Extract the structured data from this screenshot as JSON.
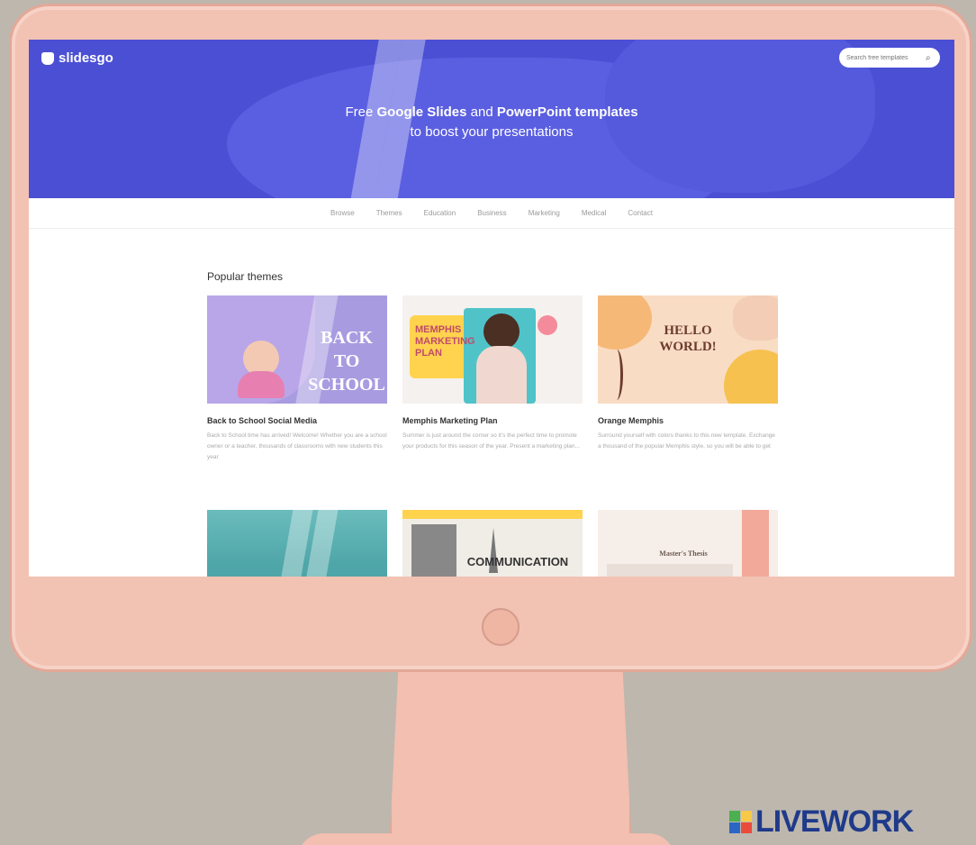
{
  "site": {
    "logo_text": "slidesgo",
    "search_placeholder": "Search free templates"
  },
  "hero": {
    "line1_pre": "Free ",
    "line1_b1": "Google Slides",
    "line1_mid": " and ",
    "line1_b2": "PowerPoint templates",
    "line2": "to boost your presentations"
  },
  "nav": [
    "Browse",
    "Themes",
    "Education",
    "Business",
    "Marketing",
    "Medical",
    "Contact"
  ],
  "section_title": "Popular themes",
  "cards": [
    {
      "title": "Back to School Social Media",
      "desc": "Back to School time has arrived! Welcome! Whether you are a school owner or a teacher, thousands of classrooms with new students this year",
      "thumb_text": "BACK TO SCHOOL",
      "bg": "#a89be0"
    },
    {
      "title": "Memphis Marketing Plan",
      "desc": "Summer is just around the corner so it's the perfect time to promote your products for this season of the year. Present a marketing plan...",
      "thumb_text": "MEMPHIS MARKETING PLAN",
      "bg": "#f5f1ee"
    },
    {
      "title": "Orange Memphis",
      "desc": "Surround yourself with colors thanks to this new template. Exchange a thousand of the popular Memphis style, so you will be able to get",
      "thumb_text": "HELLO WORLD!",
      "bg": "#f9dcc4"
    },
    {
      "thumb_text": "",
      "bg": "#4fa6a8"
    },
    {
      "thumb_text": "COMMUNICATION",
      "bg": "#f0ede6"
    },
    {
      "thumb_text": "Master's Thesis",
      "bg": "#f6eee9"
    }
  ],
  "watermark": "LIVEWORK"
}
